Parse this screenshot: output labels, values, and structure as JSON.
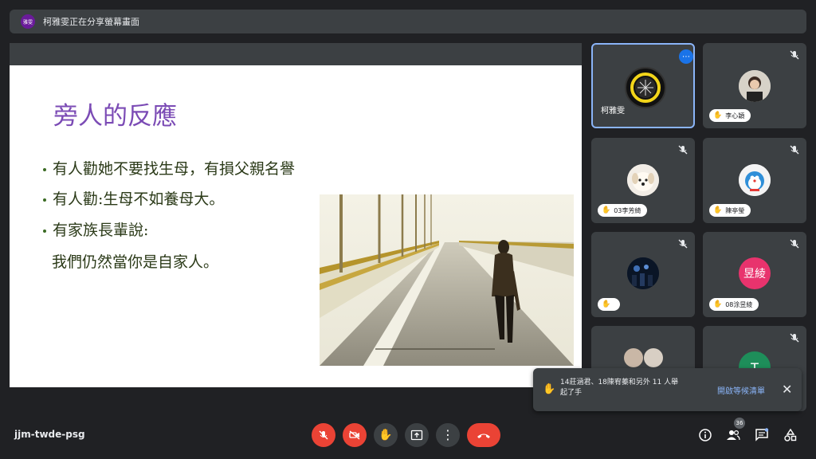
{
  "topbar": {
    "avatar_text": "雅雯",
    "title": "柯雅雯正在分享螢幕畫面"
  },
  "slide": {
    "title": "旁人的反應",
    "bullets": [
      "有人勸她不要找生母，有損父親名譽",
      "有人勸:生母不如養母大。",
      "有家族長輩說:"
    ],
    "continuation": "我們仍然當你是自家人。"
  },
  "participants": [
    {
      "name": "柯雅雯",
      "active": true
    },
    {
      "name": "李心穎"
    },
    {
      "name": "03李芳綺"
    },
    {
      "name": "陳亭瑩"
    },
    {
      "name": ""
    },
    {
      "name": "08涂昱綾",
      "avatar_letters": "昱綾"
    },
    {
      "name": ""
    },
    {
      "name": "",
      "avatar_letters": "T"
    }
  ],
  "toast": {
    "message": "14莊涵君、18陳宥蓁和另外 11 人舉起了手",
    "link_label": "開啟等候清單",
    "close_symbol": "✕"
  },
  "bottom": {
    "meeting_code": "jjm-twde-psg",
    "participant_count": "36"
  },
  "colors": {
    "mic_off_red": "#ea4335",
    "accent_blue": "#8ab4f8",
    "bg": "#202124",
    "tile": "#3c4043"
  }
}
